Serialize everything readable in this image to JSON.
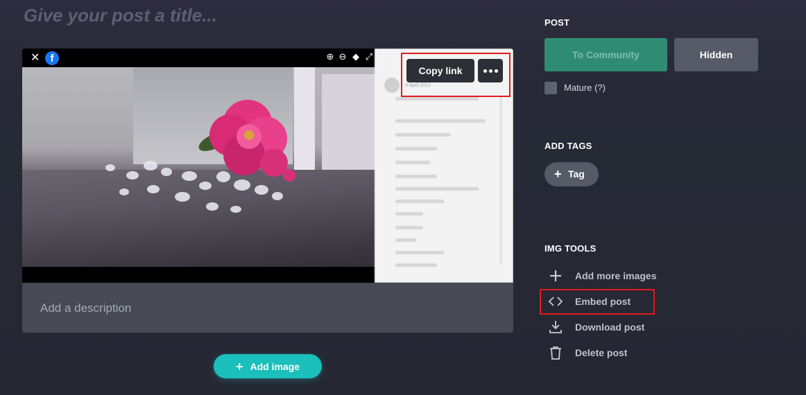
{
  "post": {
    "title_placeholder": "Give your post a title...",
    "description_placeholder": "Add a description",
    "add_image_label": "Add image"
  },
  "viewer": {
    "copy_link_label": "Copy link",
    "side_date": "3 April 2012 ·"
  },
  "sidebar": {
    "post_heading": "POST",
    "community_label": "To Community",
    "hidden_label": "Hidden",
    "mature_label": "Mature (?)",
    "tags_heading": "ADD TAGS",
    "tag_label": "Tag",
    "tools_heading": "IMG TOOLS",
    "tools": [
      {
        "label": "Add more images",
        "icon": "plus-icon"
      },
      {
        "label": "Embed post",
        "icon": "code-icon"
      },
      {
        "label": "Download post",
        "icon": "download-icon"
      },
      {
        "label": "Delete post",
        "icon": "trash-icon"
      }
    ]
  },
  "colors": {
    "accent_teal": "#1bbfbb",
    "community_green": "#2f8c73",
    "highlight_red": "#e21b1b",
    "facebook_blue": "#1877f2"
  }
}
